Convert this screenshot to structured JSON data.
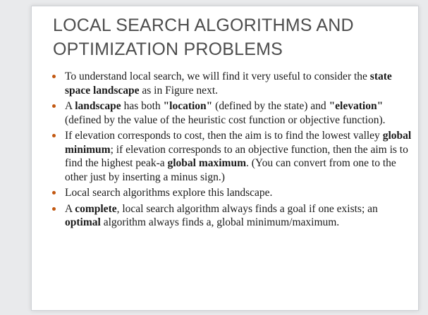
{
  "slide": {
    "title_line1": "LOCAL SEARCH ALGORITHMS AND",
    "title_line2": "OPTIMIZATION PROBLEMS",
    "accent_color": "#c2570f",
    "bullets": [
      {
        "p1": "To understand local search, we will find it very useful to consider the ",
        "p2": "state space landscape",
        "p3": " as in Figure next."
      },
      {
        "p1": "A ",
        "p2": "landscape",
        "p3": " has both ",
        "p4": "\"location\"",
        "p5": " (defined by the state) and ",
        "p6": "\"elevation\"",
        "p7": " (defined by the value of the heuristic cost function or objective function)."
      },
      {
        "p1": "If elevation corresponds to cost, then the aim is to find the lowest valley ",
        "p2": "global minimum",
        "p3": "; if elevation corresponds to an objective function, then the aim is to find the highest peak-a ",
        "p4": "global maximum",
        "p5": ". (You can convert from one to the other just by inserting a minus sign.)"
      },
      {
        "p1": "Local search algorithms explore this landscape."
      },
      {
        "p1": "A ",
        "p2": "complete",
        "p3": ", local search algorithm always finds a goal if one exists; an ",
        "p4": "optimal",
        "p5": " algorithm always finds a, global minimum/maximum."
      }
    ]
  }
}
